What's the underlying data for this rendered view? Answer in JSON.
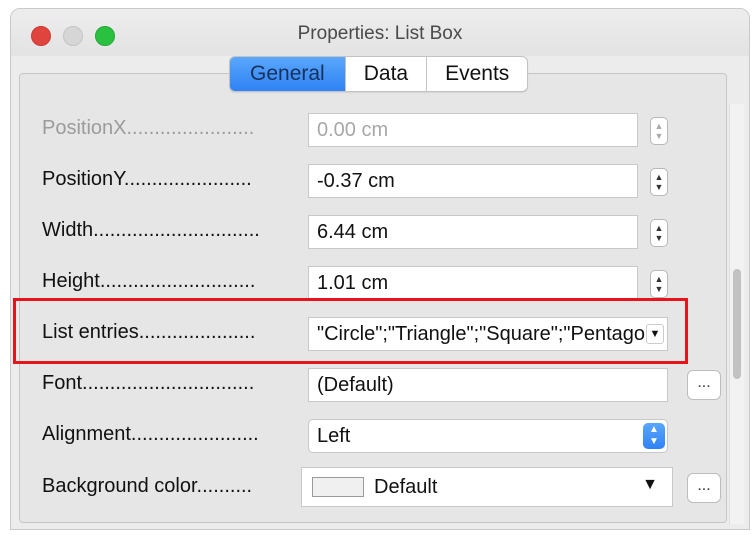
{
  "window": {
    "title": "Properties: List Box"
  },
  "tabs": [
    {
      "label": "General",
      "active": true
    },
    {
      "label": "Data",
      "active": false
    },
    {
      "label": "Events",
      "active": false
    }
  ],
  "properties": {
    "position_x": {
      "label": "PositionX.......................",
      "value": "0.00 cm"
    },
    "position_y": {
      "label": "PositionY.......................",
      "value": "-0.37 cm"
    },
    "width": {
      "label": "Width..............................",
      "value": "6.44 cm"
    },
    "height": {
      "label": "Height............................",
      "value": "1.01 cm"
    },
    "list_entries": {
      "label": "List entries.....................",
      "value": "\"Circle\";\"Triangle\";\"Square\";\"Pentagon\""
    },
    "font": {
      "label": "Font...............................",
      "value": "(Default)",
      "button": "..."
    },
    "alignment": {
      "label": "Alignment.......................",
      "value": "Left"
    },
    "background_color": {
      "label": "Background color..........",
      "value": "Default",
      "button": "..."
    }
  },
  "colors": {
    "highlight": "#e8141b",
    "tab_active": "#2f82f5"
  }
}
